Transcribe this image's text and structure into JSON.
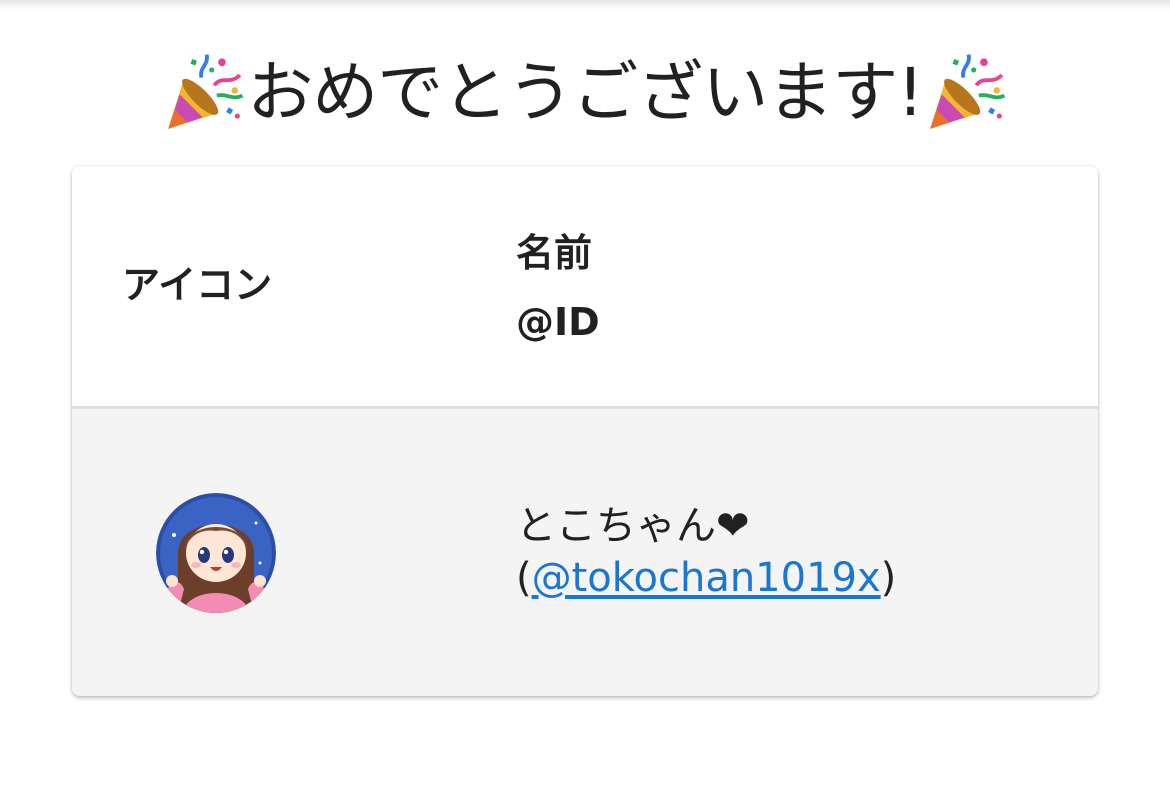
{
  "title": {
    "text": "おめでとうございます!",
    "left_icon": "party-popper-icon",
    "right_icon": "party-popper-icon"
  },
  "table": {
    "headers": {
      "icon": "アイコン",
      "name": "名前",
      "id": "@ID"
    },
    "rows": [
      {
        "avatar": "avatar-anime-girl",
        "name": "とこちゃん❤",
        "open_paren": "(",
        "handle": "@tokochan1019x",
        "close_paren": ")"
      }
    ]
  },
  "colors": {
    "link": "#1976d2",
    "row_background": "#f4f4f4",
    "text": "#212121"
  }
}
